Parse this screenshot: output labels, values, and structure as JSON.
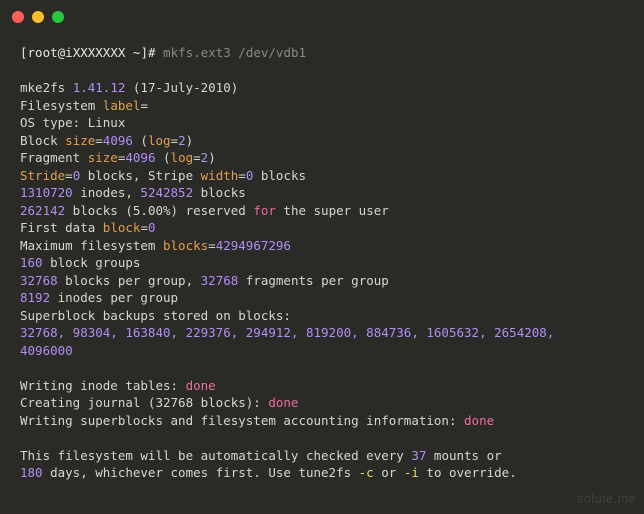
{
  "prompt": {
    "user": "root",
    "host": "iXXXXXXX",
    "cwd": "~",
    "symbol": "#",
    "command": "mkfs.ext3 /dev/vdb1"
  },
  "version_line": {
    "pre": "mke2fs ",
    "ver": "1.41.12",
    "post": " (17-July-2010)"
  },
  "fs_label": {
    "pre": "Filesystem ",
    "k": "label",
    "eq": "="
  },
  "os_type": "OS type: Linux",
  "block_size": {
    "pre": "Block ",
    "k": "size",
    "eq": "=",
    "v": "4096",
    "paren_pre": " (",
    "k2": "log",
    "eq2": "=",
    "v2": "2",
    "paren_post": ")"
  },
  "fragment": {
    "pre": "Fragment ",
    "k": "size",
    "eq": "=",
    "v": "4096",
    "paren_pre": " (",
    "k2": "log",
    "eq2": "=",
    "v2": "2",
    "paren_post": ")"
  },
  "stride": {
    "k1": "Stride",
    "eq1": "=",
    "v1": "0",
    "mid1": " blocks, Stripe ",
    "k2": "width",
    "eq2": "=",
    "v2": "0",
    "post": " blocks"
  },
  "inodes_blocks": {
    "v1": "1310720",
    "t1": " inodes, ",
    "v2": "5242852",
    "t2": " blocks"
  },
  "reserved": {
    "v": "262142",
    "t1": " blocks (5.00%) reserved ",
    "for": "for",
    "t2": " the super user"
  },
  "first_data": {
    "pre": "First data ",
    "k": "block",
    "eq": "=",
    "v": "0"
  },
  "max_blocks": {
    "pre": "Maximum filesystem ",
    "k": "blocks",
    "eq": "=",
    "v": "4294967296"
  },
  "block_groups": {
    "v": "160",
    "t": " block groups"
  },
  "per_group": {
    "v1": "32768",
    "t1": " blocks per group, ",
    "v2": "32768",
    "t2": " fragments per group"
  },
  "inodes_pg": {
    "v": "8192",
    "t": " inodes per group"
  },
  "backup_hdr": "Superblock backups stored on blocks:",
  "backup_l1": "32768, 98304, 163840, 229376, 294912, 819200, 884736, 1605632, 2654208, ",
  "backup_l2": "4096000",
  "writing_inode": {
    "t": "Writing inode tables: ",
    "d": "done"
  },
  "journal": {
    "t": "Creating journal (32768 blocks): ",
    "d": "done"
  },
  "superblocks": {
    "t": "Writing superblocks and filesystem accounting information: ",
    "d": "done"
  },
  "autocheck_l1": {
    "t1": "This filesystem will be automatically checked every ",
    "v": "37",
    "t2": " mounts or"
  },
  "autocheck_l2": {
    "v": "180",
    "t1": " days, whichever comes first. Use tune2fs ",
    "f1": "-c",
    "t2": " or ",
    "f2": "-i",
    "t3": " to override."
  },
  "watermark": "solute.me"
}
